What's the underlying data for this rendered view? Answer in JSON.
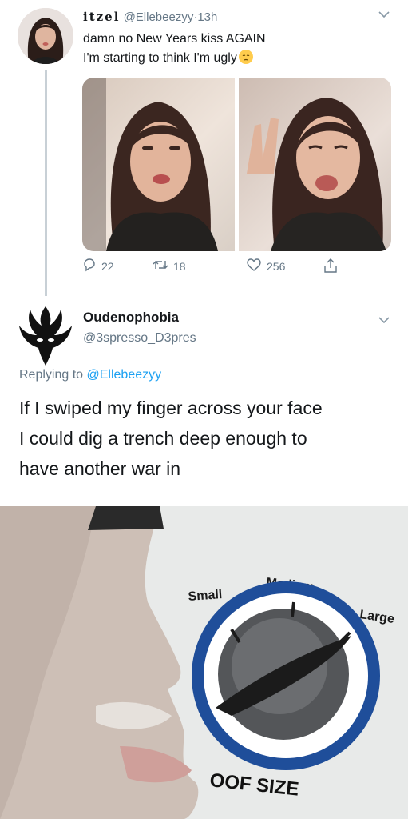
{
  "tweet1": {
    "display_name": "itzel",
    "handle": "@Ellebeezyy",
    "separator": "·",
    "time": "13h",
    "text_line1": "damn no New Years kiss AGAIN",
    "text_line2": "I'm starting to think I'm ugly",
    "emoji": "pensive-face-emoji",
    "replies": "22",
    "retweets": "18",
    "likes": "256"
  },
  "tweet2": {
    "display_name": "Oudenophobia",
    "handle": "@3spresso_D3pres",
    "replying_prefix": "Replying to",
    "replying_handle": "@Ellebeezyy",
    "text_line1": "If I swiped my finger across your face",
    "text_line2": "I could dig a trench deep enough to",
    "text_line3": "have another war in"
  },
  "meme": {
    "label_small": "Small",
    "label_medium": "Medium",
    "label_large": "Large",
    "caption": "OOF SIZE"
  },
  "icons": [
    "reply-icon",
    "retweet-icon",
    "like-icon",
    "share-icon",
    "chevron-down-icon"
  ],
  "colors": {
    "text": "#14171a",
    "muted": "#657786",
    "link": "#1da1f2",
    "thread": "#c8d0d6",
    "dial_ring": "#1f4e9a"
  }
}
